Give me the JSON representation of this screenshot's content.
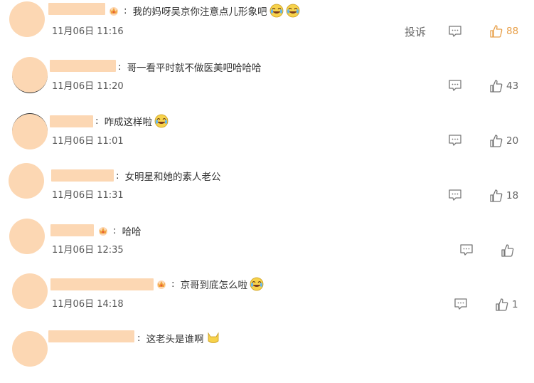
{
  "report_label": "投诉",
  "colors": {
    "liked": "#e8a04a",
    "avatar": "#fcd7b3"
  },
  "comments": [
    {
      "text": "我的妈呀吴京你注意点儿形象吧",
      "time": "11月06日 11:16",
      "likes": "88",
      "liked": true,
      "badge": true,
      "emojis": [
        "laugh-cry-emoji",
        "laugh-cry-emoji"
      ]
    },
    {
      "text": "哥一看平时就不做医美吧哈哈哈",
      "time": "11月06日 11:20",
      "likes": "43",
      "liked": false,
      "badge": false,
      "emojis": []
    },
    {
      "text": "咋成这样啦",
      "time": "11月06日 11:01",
      "likes": "20",
      "liked": false,
      "badge": false,
      "emojis": [
        "laugh-cry-emoji"
      ]
    },
    {
      "text": "女明星和她的素人老公",
      "time": "11月06日 11:31",
      "likes": "18",
      "liked": false,
      "badge": false,
      "emojis": []
    },
    {
      "text": "哈哈",
      "time": "11月06日 12:35",
      "likes": "",
      "liked": false,
      "badge": true,
      "emojis": []
    },
    {
      "text": "京哥到底怎么啦",
      "time": "11月06日 14:18",
      "likes": "1",
      "liked": false,
      "badge": true,
      "emojis": [
        "laugh-cry-emoji"
      ]
    },
    {
      "text": "这老头是谁啊",
      "time": "",
      "likes": "",
      "liked": false,
      "badge": false,
      "emojis": [
        "cat-emoji"
      ]
    }
  ]
}
